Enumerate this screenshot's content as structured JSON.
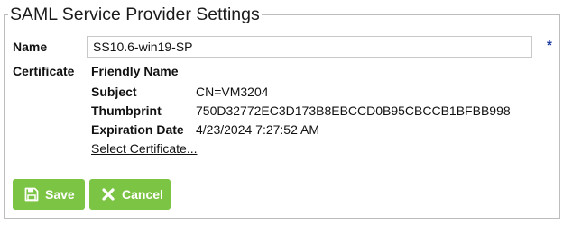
{
  "section": {
    "title": "SAML Service Provider Settings"
  },
  "name_field": {
    "label": "Name",
    "value": "SS10.6-win19-SP",
    "required_marker": "*"
  },
  "certificate": {
    "label": "Certificate",
    "friendly_name_label": "Friendly Name",
    "friendly_name_value": "",
    "subject_label": "Subject",
    "subject_value": "CN=VM3204",
    "thumbprint_label": "Thumbprint",
    "thumbprint_value": "750D32772EC3D173B8EBCCD0B95CBCCB1BFBB998",
    "expiration_label": "Expiration Date",
    "expiration_value": "4/23/2024 7:27:52 AM",
    "select_link": "Select Certificate..."
  },
  "buttons": {
    "save_label": "Save",
    "cancel_label": "Cancel"
  },
  "icons": {
    "save": "floppy-disk-icon",
    "cancel": "x-icon"
  },
  "colors": {
    "button_green": "#7cc443",
    "required_star": "#1a3aa0"
  }
}
